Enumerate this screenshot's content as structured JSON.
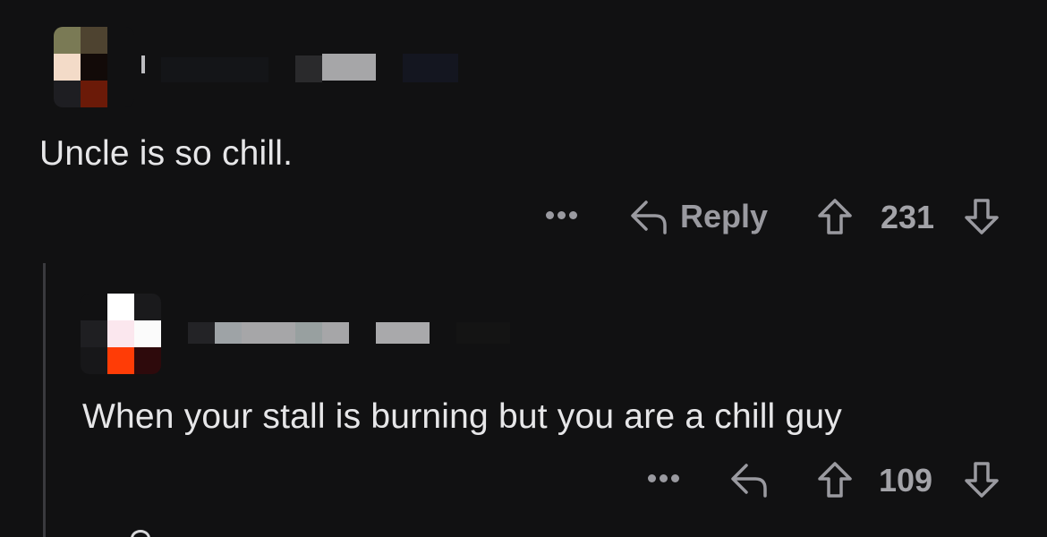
{
  "comments": [
    {
      "text": "Uncle is so chill.",
      "reply_label": "Reply",
      "vote_count": "231"
    },
    {
      "text": "When your stall is burning but you are a chill guy",
      "vote_count": "109"
    }
  ],
  "colors": {
    "background": "#111112",
    "text": "#e6e6e8",
    "muted": "#9a9aa0",
    "thread_line": "#3a3a3e"
  },
  "icons": [
    "more-icon",
    "reply-icon",
    "upvote-icon",
    "downvote-icon"
  ]
}
